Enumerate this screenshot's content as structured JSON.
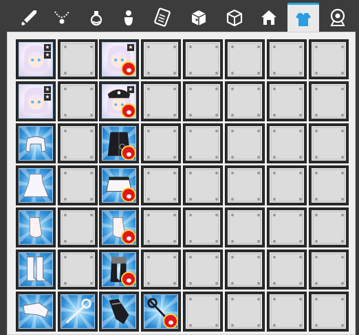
{
  "tabs": [
    {
      "name": "weapon-tab",
      "icon": "sword-icon",
      "active": false
    },
    {
      "name": "accessory-tab",
      "icon": "necklace-icon",
      "active": false
    },
    {
      "name": "potion-tab",
      "icon": "potion-icon",
      "active": false
    },
    {
      "name": "bag-tab",
      "icon": "bag-icon",
      "active": false
    },
    {
      "name": "card-tab",
      "icon": "card-icon",
      "active": false
    },
    {
      "name": "box-tab",
      "icon": "box-icon",
      "active": false
    },
    {
      "name": "box-open-tab",
      "icon": "box-open-icon",
      "active": false
    },
    {
      "name": "house-tab",
      "icon": "house-icon",
      "active": false
    },
    {
      "name": "costume-tab",
      "icon": "shirt-icon",
      "active": true
    },
    {
      "name": "pet-tab",
      "icon": "pet-icon",
      "active": false
    }
  ],
  "grid": {
    "rows": 7,
    "cols": 8,
    "items": [
      {
        "row": 0,
        "col": 0,
        "type": "face",
        "label": "hair-white-icon",
        "stars": 2,
        "paw": false
      },
      {
        "row": 0,
        "col": 2,
        "type": "face",
        "label": "hair-white-icon",
        "stars": 1,
        "paw": true
      },
      {
        "row": 1,
        "col": 0,
        "type": "face",
        "label": "hair-white-icon",
        "stars": 2,
        "paw": false
      },
      {
        "row": 1,
        "col": 2,
        "type": "face",
        "label": "hat-black-icon",
        "stars": 1,
        "paw": true
      },
      {
        "row": 2,
        "col": 0,
        "type": "item",
        "label": "top-white-icon",
        "stars": 0,
        "paw": false
      },
      {
        "row": 2,
        "col": 2,
        "type": "item",
        "label": "coat-black-icon",
        "stars": 0,
        "paw": true
      },
      {
        "row": 3,
        "col": 0,
        "type": "item",
        "label": "dress-white-icon",
        "stars": 0,
        "paw": false
      },
      {
        "row": 3,
        "col": 2,
        "type": "item",
        "label": "skirt-white-icon",
        "stars": 0,
        "paw": true
      },
      {
        "row": 4,
        "col": 0,
        "type": "item",
        "label": "gloves-white-icon",
        "stars": 0,
        "paw": false
      },
      {
        "row": 4,
        "col": 2,
        "type": "item",
        "label": "gloves-white-icon",
        "stars": 0,
        "paw": true
      },
      {
        "row": 5,
        "col": 0,
        "type": "item",
        "label": "boots-white-icon",
        "stars": 0,
        "paw": false
      },
      {
        "row": 5,
        "col": 2,
        "type": "item",
        "label": "boots-black-icon",
        "stars": 0,
        "paw": true
      },
      {
        "row": 6,
        "col": 0,
        "type": "item",
        "label": "gauntlet-white-icon",
        "stars": 0,
        "paw": false
      },
      {
        "row": 6,
        "col": 1,
        "type": "item",
        "label": "staff-icon",
        "stars": 0,
        "paw": false
      },
      {
        "row": 6,
        "col": 2,
        "type": "item",
        "label": "gauntlet-black-icon",
        "stars": 0,
        "paw": false
      },
      {
        "row": 6,
        "col": 3,
        "type": "item",
        "label": "staff-black-icon",
        "stars": 0,
        "paw": true
      }
    ]
  },
  "colors": {
    "active_tab_accent": "#2aa8e8",
    "paw_badge": "#e01818",
    "item_bg": "#2f8fd6"
  }
}
